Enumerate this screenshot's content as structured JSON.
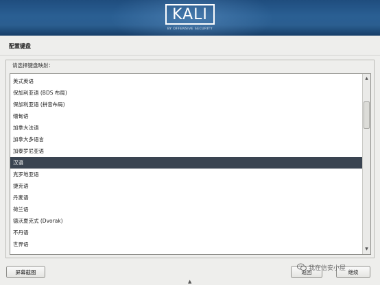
{
  "banner": {
    "logo_text": "KALI",
    "tagline": "BY OFFENSIVE SECURITY"
  },
  "page": {
    "title": "配置键盘",
    "prompt": "请选择键盘映射："
  },
  "keymap_list": {
    "selected_index": 7,
    "items": [
      "英式英语",
      "保加利亚语 (BDS 布局)",
      "保加利亚语 (拼音布局)",
      "缅甸语",
      "加拿大法语",
      "加拿大多语言",
      "加泰罗尼亚语",
      "汉语",
      "克罗地亚语",
      "捷克语",
      "丹麦语",
      "荷兰语",
      "德沃夏克式 (Dvorak)",
      "不丹语",
      "世界语"
    ]
  },
  "scrollbar": {
    "up_icon": "triangle-up-icon",
    "down_icon": "triangle-down-icon"
  },
  "buttons": {
    "screenshot": "屏幕截图",
    "back": "返回",
    "continue": "继续"
  },
  "watermark": {
    "text": "我在信安小屋",
    "icon": "wechat-icon"
  }
}
